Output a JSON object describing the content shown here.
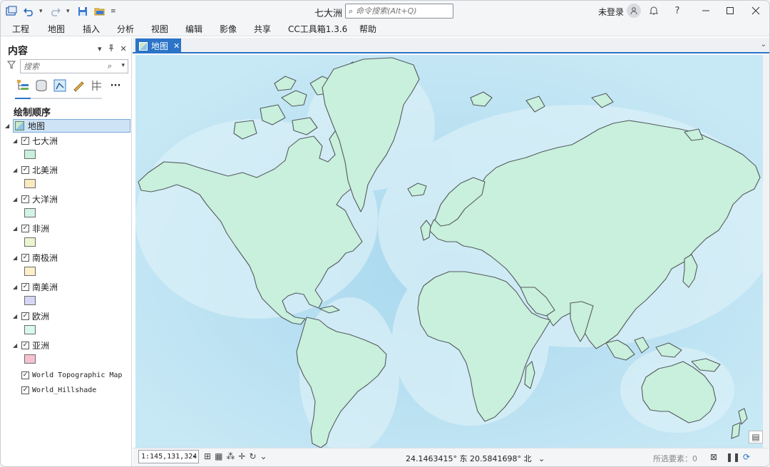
{
  "window": {
    "title": "七大洲",
    "search_placeholder": "命令搜索(Alt+Q)",
    "user": "未登录",
    "controls": [
      "minimize",
      "maximize",
      "close"
    ]
  },
  "menu": [
    "工程",
    "地图",
    "插入",
    "分析",
    "视图",
    "编辑",
    "影像",
    "共享",
    "CC工具箱1.3.6",
    "帮助"
  ],
  "contents_pane": {
    "title": "内容",
    "search_placeholder": "搜索",
    "section": "绘制顺序",
    "map_name": "地图",
    "layers": [
      {
        "name": "七大洲",
        "checked": true,
        "swatch": "#c8f0dc"
      },
      {
        "name": "北美洲",
        "checked": true,
        "swatch": "#fbe9c0"
      },
      {
        "name": "大洋洲",
        "checked": true,
        "swatch": "#d2f3e6"
      },
      {
        "name": "非洲",
        "checked": true,
        "swatch": "#eaf6cf"
      },
      {
        "name": "南极洲",
        "checked": true,
        "swatch": "#fcefc9"
      },
      {
        "name": "南美洲",
        "checked": true,
        "swatch": "#d6d6f6"
      },
      {
        "name": "欧洲",
        "checked": true,
        "swatch": "#d8f8ee"
      },
      {
        "name": "亚洲",
        "checked": true,
        "swatch": "#f6c2d0"
      }
    ],
    "basemaps": [
      {
        "name": "World Topographic Map",
        "checked": true
      },
      {
        "name": "World_Hillshade",
        "checked": true
      }
    ]
  },
  "map_tab": {
    "label": "地图",
    "close_glyph": "✕"
  },
  "status_bar": {
    "scale": "1:145,131,324",
    "coordinates": "24.1463415° 东 20.5841698° 北",
    "selected_features": "所选要素：0"
  },
  "colors": {
    "accent": "#2b74c7",
    "land": "#c8f0dc",
    "ocean": "#bfe3f2",
    "coast": "#555a5f"
  },
  "icons": [
    "undo-icon",
    "redo-icon",
    "save-icon",
    "open-icon",
    "search-icon",
    "bell-icon",
    "help-icon",
    "filter-icon",
    "pin-icon",
    "close-icon"
  ]
}
